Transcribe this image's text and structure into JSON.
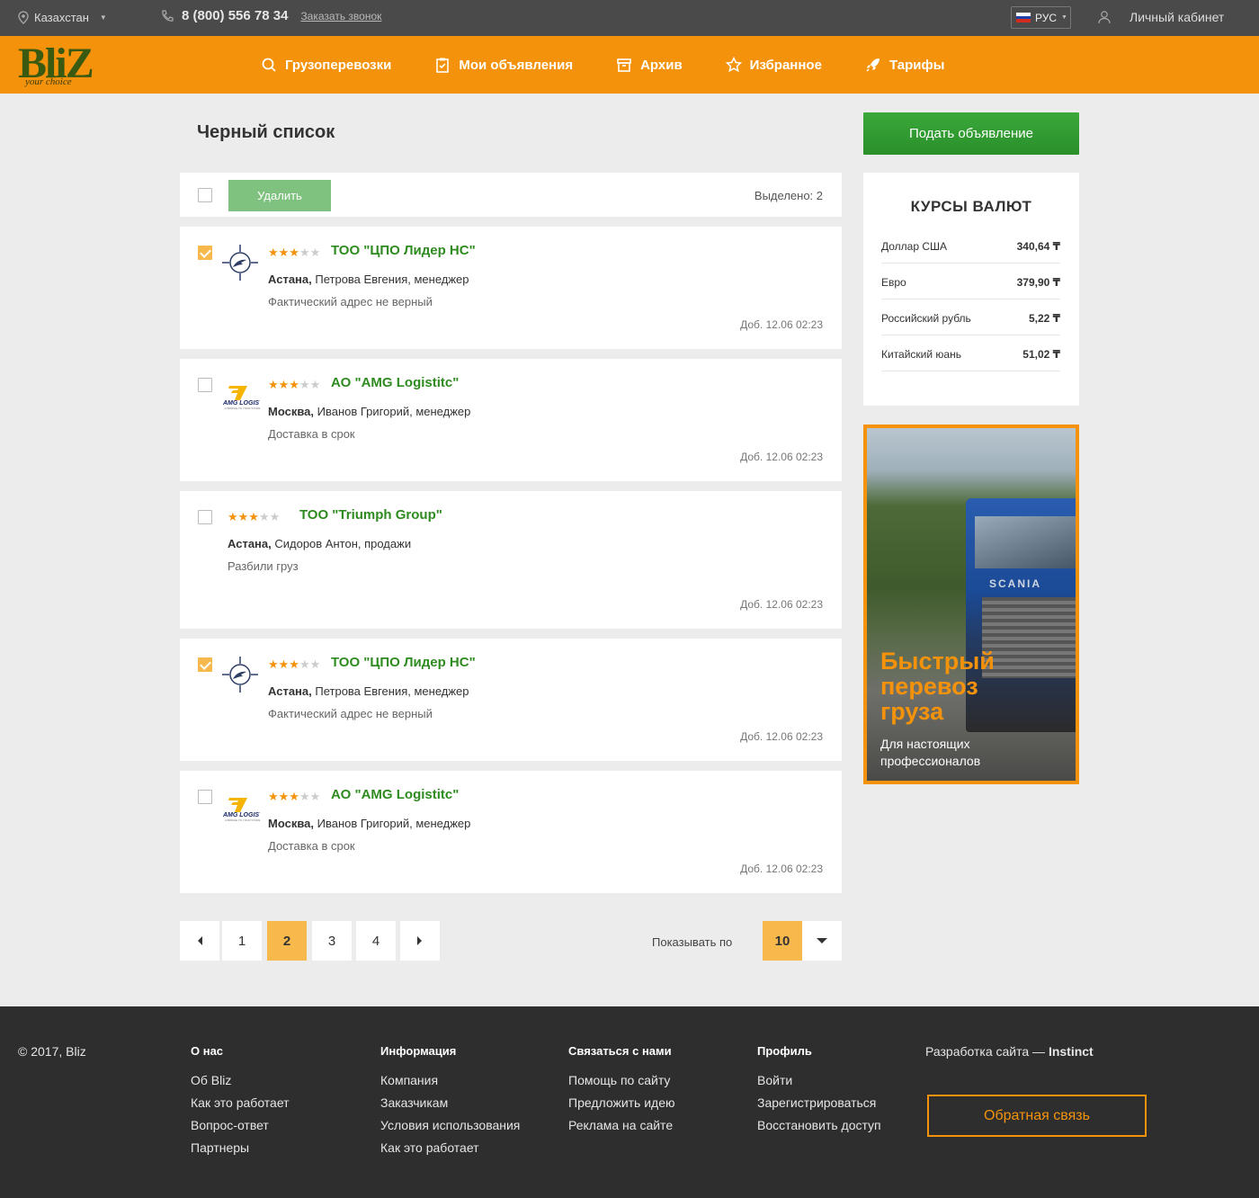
{
  "topbar": {
    "location": "Казахстан",
    "phone": "8 (800) 556 78 34",
    "callback": "Заказать звонок",
    "language": "РУС",
    "account": "Личный кабинет"
  },
  "logo": {
    "main": "BliZ",
    "tagline": "your choice"
  },
  "nav": [
    {
      "label": "Грузоперевозки",
      "icon": "search-icon"
    },
    {
      "label": "Мои объявления",
      "icon": "clipboard-icon"
    },
    {
      "label": "Архив",
      "icon": "archive-icon"
    },
    {
      "label": "Избранное",
      "icon": "star-icon"
    },
    {
      "label": "Тарифы",
      "icon": "rocket-icon"
    }
  ],
  "page": {
    "title": "Черный список"
  },
  "toolbar": {
    "delete_label": "Удалить",
    "selected_label": "Выделено: 2"
  },
  "cards": [
    {
      "checked": true,
      "logo": "compass-logo",
      "rating": 3,
      "company": "ТОО \"ЦПО Лидер НС\"",
      "city": "Астана,",
      "person": " Петрова Евгения, менеджер",
      "reason": "Фактический адрес не верный",
      "added": "Доб. 12.06  02:23"
    },
    {
      "checked": false,
      "logo": "amg-logistic-logo",
      "rating": 3,
      "company": "АО \"AMG Logistitc\"",
      "city": "Москва,",
      "person": " Иванов Григорий, менеджер",
      "reason": "Доставка в срок",
      "added": "Доб. 12.06  02:23"
    },
    {
      "checked": false,
      "logo": "",
      "rating": 3,
      "company": "ТОО \"Triumph Group\"",
      "city": "Астана,",
      "person": " Сидоров Антон, продажи",
      "reason": "Разбили груз",
      "added": "Доб. 12.06  02:23"
    },
    {
      "checked": true,
      "logo": "compass-logo",
      "rating": 3,
      "company": "ТОО \"ЦПО Лидер НС\"",
      "city": "Астана,",
      "person": " Петрова Евгения, менеджер",
      "reason": "Фактический адрес не верный",
      "added": "Доб. 12.06  02:23"
    },
    {
      "checked": false,
      "logo": "amg-logistic-logo",
      "rating": 3,
      "company": "АО \"AMG Logistitc\"",
      "city": "Москва,",
      "person": " Иванов Григорий, менеджер",
      "reason": "Доставка в срок",
      "added": "Доб. 12.06  02:23"
    }
  ],
  "pagination": {
    "pages": [
      "1",
      "2",
      "3",
      "4"
    ],
    "current": "2",
    "per_page_label": "Показывать по",
    "per_page": "10"
  },
  "sidebar": {
    "post_button": "Подать объявление",
    "rates_title": "КУРСЫ ВАЛЮТ",
    "rates": [
      {
        "name": "Доллар США",
        "value": "340,64 ₸"
      },
      {
        "name": "Евро",
        "value": "379,90 ₸"
      },
      {
        "name": "Российский рубль",
        "value": "5,22 ₸"
      },
      {
        "name": "Китайский юань",
        "value": "51,02 ₸"
      }
    ],
    "banner": {
      "headline": "Быстрый перевоз груза",
      "sub": "Для настоящих профессионалов",
      "truck_brand": "SCANIA"
    }
  },
  "footer": {
    "copyright": "© 2017, Bliz",
    "columns": [
      {
        "title": "О нас",
        "links": [
          "Об Bliz",
          "Как это работает",
          "Вопрос-ответ",
          "Партнеры"
        ]
      },
      {
        "title": "Информация",
        "links": [
          "Компания",
          "Заказчикам",
          "Условия использования",
          "Как это работает"
        ]
      },
      {
        "title": "Связаться с нами",
        "links": [
          "Помощь по сайту",
          "Предложить идею",
          "Реклама на сайте"
        ]
      },
      {
        "title": "Профиль",
        "links": [
          "Войти",
          "Зарегистрироваться",
          "Восстановить доступ"
        ]
      }
    ],
    "dev_prefix": "Разработка сайта — ",
    "dev_name": "Instinct",
    "feedback": "Обратная связь"
  },
  "colors": {
    "accent": "#f4930b",
    "green": "#2e8b1f",
    "button_green": "#3aa83a",
    "topbar": "#4a4a4a",
    "footer": "#2e2e2e"
  }
}
